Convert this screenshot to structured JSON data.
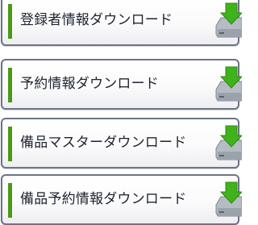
{
  "menu": {
    "items": [
      {
        "label": "登録者情報ダウンロード",
        "icon": "download-drive-icon"
      },
      {
        "label": "予約情報ダウンロード",
        "icon": "download-drive-icon"
      },
      {
        "label": "備品マスターダウンロード",
        "icon": "download-drive-icon"
      },
      {
        "label": "備品予約情報ダウンロード",
        "icon": "download-drive-icon"
      }
    ]
  },
  "colors": {
    "accent_bar": "#4a9a16",
    "border": "#6d7387",
    "arrow": "#3fb21c",
    "drive": "#b5bcc4"
  }
}
